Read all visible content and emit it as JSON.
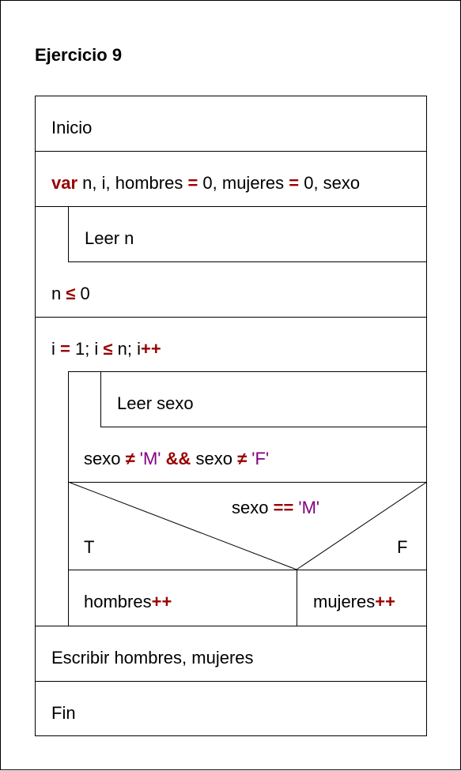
{
  "title": "Ejercicio 9",
  "blocks": {
    "inicio": "Inicio",
    "var_line": {
      "kw": "var",
      "p1": " n, i, hombres ",
      "eq1": "=",
      "p2": " 0, mujeres ",
      "eq2": "=",
      "p3": " 0, sexo"
    },
    "leer_n": "Leer n",
    "until_n": {
      "p1": "n ",
      "op": "≤",
      "p2": " 0"
    },
    "for_line": {
      "p1": "i ",
      "eq": "=",
      "p2": " 1; i ",
      "op": "≤",
      "p3": " n; i",
      "inc": "++"
    },
    "leer_sexo": "Leer sexo",
    "until_sexo": {
      "p1": "sexo ",
      "ne1": "≠",
      "s1": " 'M' ",
      "and": "&&",
      "p2": " sexo ",
      "ne2": "≠",
      "s2": " 'F'"
    },
    "if_cond": {
      "p1": "sexo ",
      "eqeq": "==",
      "s1": " 'M'"
    },
    "true_label": "T",
    "false_label": "F",
    "hombres_inc": {
      "p1": "hombres",
      "inc": "++"
    },
    "mujeres_inc": {
      "p1": "mujeres",
      "inc": "++"
    },
    "escribir": "Escribir hombres, mujeres",
    "fin": "Fin"
  },
  "colors": {
    "keyword": "#990000",
    "string": "#800080",
    "line": "#000000"
  }
}
